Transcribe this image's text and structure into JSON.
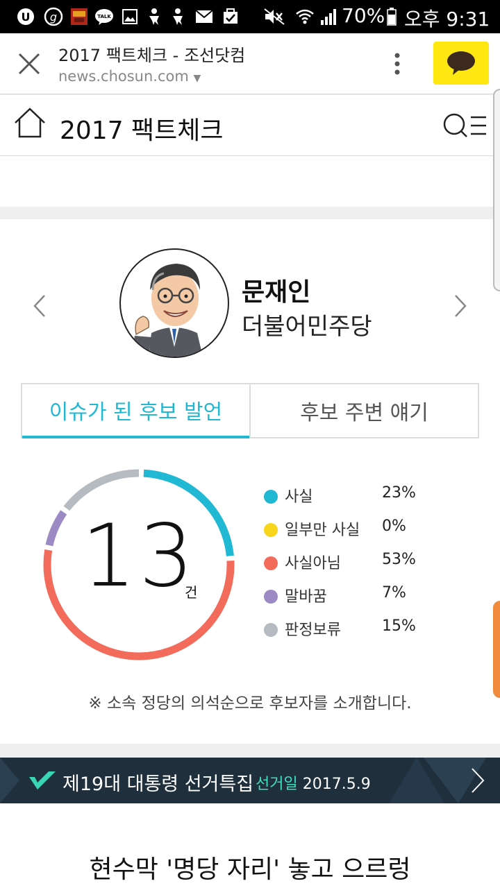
{
  "status_bar": {
    "battery_text": "70%",
    "time_text": "오후 9:31",
    "left_icons": [
      "uplus-icon",
      "g-app-icon",
      "game-app-icon",
      "kakaotalk-icon",
      "gallery-icon",
      "person-notify-icon",
      "person-notify-icon",
      "mail-icon",
      "task-icon"
    ],
    "right_icons": [
      "mute-icon",
      "wifi-icon",
      "signal-icon",
      "battery-icon"
    ]
  },
  "browser": {
    "tab_title": "2017 팩트체크 - 조선닷컴",
    "url": "news.chosun.com",
    "url_dropdown_icon": "caret-down-icon",
    "kakao_color": "#ffe812"
  },
  "site": {
    "title": "2017 팩트체크"
  },
  "candidate": {
    "name": "문재인",
    "party": "더불어민주당"
  },
  "tabs": [
    {
      "label": "이슈가 된 후보 발언",
      "active": true
    },
    {
      "label": "후보 주변 얘기",
      "active": false
    }
  ],
  "accent_color": "#21b8d3",
  "stats": {
    "total": "13",
    "unit": "건",
    "items": [
      {
        "label": "사실",
        "percent_text": "23%",
        "value": 23,
        "color": "#21b8d3"
      },
      {
        "label": "일부만 사실",
        "percent_text": "0%",
        "value": 0,
        "color": "#f7d51d"
      },
      {
        "label": "사실아님",
        "percent_text": "53%",
        "value": 53,
        "color": "#f26b5b"
      },
      {
        "label": "말바꿈",
        "percent_text": "7%",
        "value": 7,
        "color": "#9b8ac4"
      },
      {
        "label": "판정보류",
        "percent_text": "15%",
        "value": 15,
        "color": "#b5bbc0"
      }
    ]
  },
  "note": "※ 소속 정당의 의석순으로 후보자를 소개합니다.",
  "banner": {
    "title": "제19대 대통령 선거특집",
    "date_label": "선거일",
    "date_value": "2017.5.9"
  },
  "headline": "현수막 '명당 자리' 놓고 으르렁"
}
